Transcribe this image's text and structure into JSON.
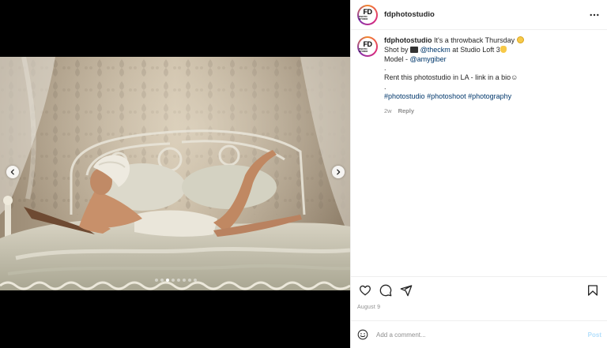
{
  "header": {
    "username": "fdphotostudio",
    "avatar": {
      "monogram": "FD",
      "subtext": "PHOTO STUDIO"
    }
  },
  "caption": {
    "username": "fdphotostudio",
    "line1_text": "It's a throwback Thursday",
    "line2_prefix": "Shot by",
    "line2_mention": "@theckm",
    "line2_suffix": "at Studio Loft 3",
    "line3_prefix": "Model -",
    "line3_mention": "@amygiber",
    "dot1": ".",
    "line4_text": "Rent this photostudio in LA - link in a bio",
    "dot2": ".",
    "hashtags": [
      "#photostudio",
      "#photoshoot",
      "#photography"
    ],
    "time_ago": "2w",
    "reply_label": "Reply"
  },
  "carousel": {
    "slide_count": 8,
    "active_index": 2
  },
  "icons": {
    "more": "more-horizontal-icon",
    "like": "heart-icon",
    "comment": "comment-bubble-icon",
    "share": "paper-plane-icon",
    "save": "bookmark-icon",
    "emoji": "smiley-icon",
    "prev": "chevron-left-icon",
    "next": "chevron-right-icon"
  },
  "post_date": "August 9",
  "comment_box": {
    "placeholder": "Add a comment...",
    "post_label": "Post"
  },
  "colors": {
    "link": "#00376b",
    "muted": "#8e8e8e",
    "post_disabled": "#b2dffc",
    "border": "#efefef"
  }
}
